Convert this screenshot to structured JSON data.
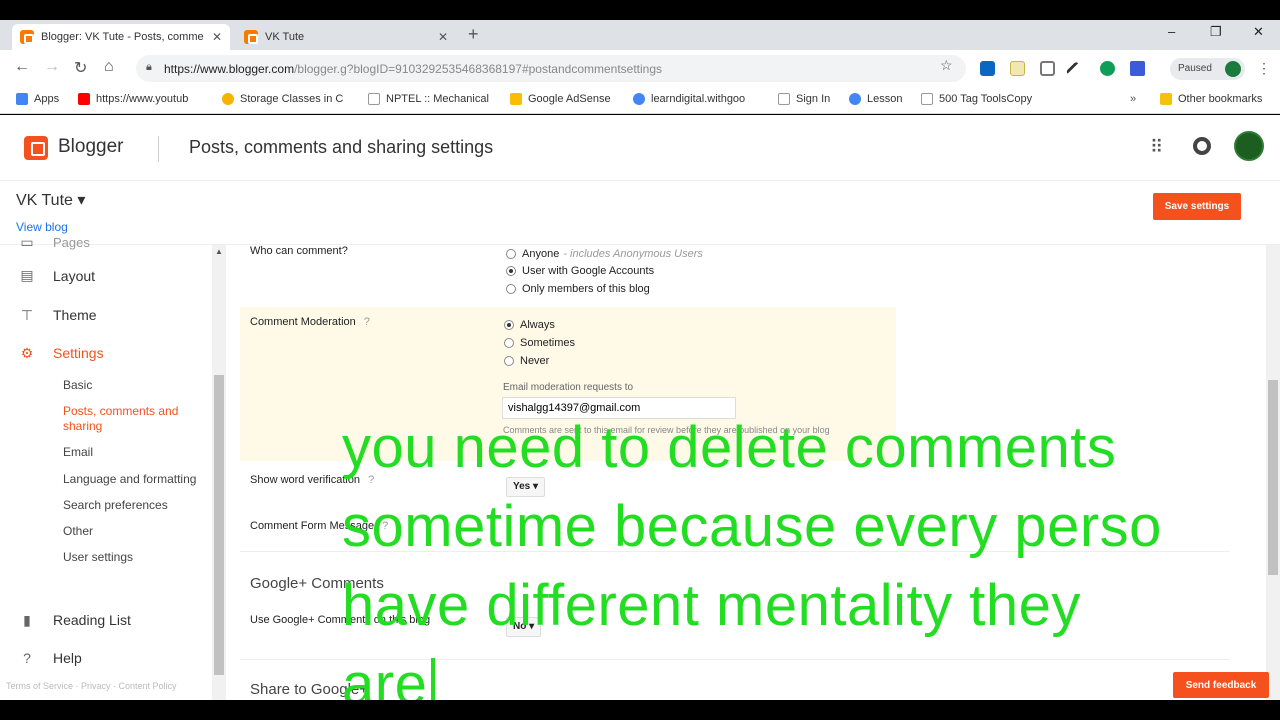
{
  "browser": {
    "tabs": [
      {
        "title": "Blogger: VK Tute - Posts, comme",
        "close": "✕"
      },
      {
        "title": "VK Tute",
        "close": "✕"
      }
    ],
    "new_tab": "+",
    "window_controls": {
      "minimize": "–",
      "restore": "❐",
      "close": "✕"
    },
    "url_main": "https://www.blogger.com",
    "url_rest": "/blogger.g?blogID=9103292535468368197#postandcommentsettings",
    "profile_status": "Paused",
    "bookmarks": [
      {
        "label": "Apps",
        "icon": "apps-icon",
        "color": "#4285f4"
      },
      {
        "label": "https://www.youtub",
        "icon": "youtube-icon",
        "color": "#ff0000"
      },
      {
        "label": "Storage Classes in C",
        "icon": "site-icon",
        "color": "#f4b400"
      },
      {
        "label": "NPTEL :: Mechanical",
        "icon": "page-icon",
        "color": "#999999"
      },
      {
        "label": "Google AdSense",
        "icon": "adsense-icon",
        "color": "#fbbc05"
      },
      {
        "label": "learndigital.withgoo",
        "icon": "google-icon",
        "color": "#4285f4"
      },
      {
        "label": "Sign In",
        "icon": "page-icon",
        "color": "#999999"
      },
      {
        "label": "Lesson",
        "icon": "google-icon",
        "color": "#4285f4"
      },
      {
        "label": "500 Tag ToolsCopy",
        "icon": "page-icon",
        "color": "#999999"
      },
      {
        "label": "Other bookmarks",
        "icon": "folder-icon",
        "color": "#f4c20d"
      }
    ]
  },
  "header": {
    "brand": "Blogger",
    "title": "Posts, comments and sharing settings"
  },
  "blog": {
    "name": "VK Tute ▾",
    "view_link": "View blog",
    "save_button": "Save settings"
  },
  "sidebar": {
    "partial_top": "Pages",
    "items": [
      {
        "label": "Layout",
        "icon": "layout-icon"
      },
      {
        "label": "Theme",
        "icon": "theme-icon"
      },
      {
        "label": "Settings",
        "icon": "gear-icon"
      }
    ],
    "sub_items": [
      {
        "label": "Basic"
      },
      {
        "label": "Posts, comments and sharing"
      },
      {
        "label": "Email"
      },
      {
        "label": "Language and formatting"
      },
      {
        "label": "Search preferences"
      },
      {
        "label": "Other"
      },
      {
        "label": "User settings"
      }
    ],
    "reading_list": "Reading List",
    "help": "Help",
    "footer": "Terms of Service · Privacy · Content Policy"
  },
  "settings": {
    "who_can_comment": {
      "label": "Who can comment?",
      "options": [
        {
          "label": "Anyone",
          "note": "- includes Anonymous Users"
        },
        {
          "label": "User with Google Accounts",
          "note": ""
        },
        {
          "label": "Only members of this blog",
          "note": ""
        }
      ],
      "selected": 1
    },
    "comment_moderation": {
      "label": "Comment Moderation",
      "help": "?",
      "options": [
        "Always",
        "Sometimes",
        "Never"
      ],
      "selected": 0,
      "email_label": "Email moderation requests to",
      "email_value": "vishalgg14397@gmail.com",
      "email_note": "Comments are sent to this email for review before they are published on your blog"
    },
    "word_verification": {
      "label": "Show word verification",
      "help": "?",
      "value": "Yes ▾"
    },
    "comment_form_message": {
      "label": "Comment Form Message",
      "help": "?"
    },
    "google_plus_section": "Google+ Comments",
    "use_google_plus": {
      "label": "Use Google+ Comments on this blog",
      "value": "No ▾"
    },
    "share_section": "Share to Google+"
  },
  "feedback_button": "Send feedback",
  "caption": {
    "lines": [
      "you need to delete comments",
      "sometime because every perso",
      "have different mentality they",
      "are"
    ]
  }
}
